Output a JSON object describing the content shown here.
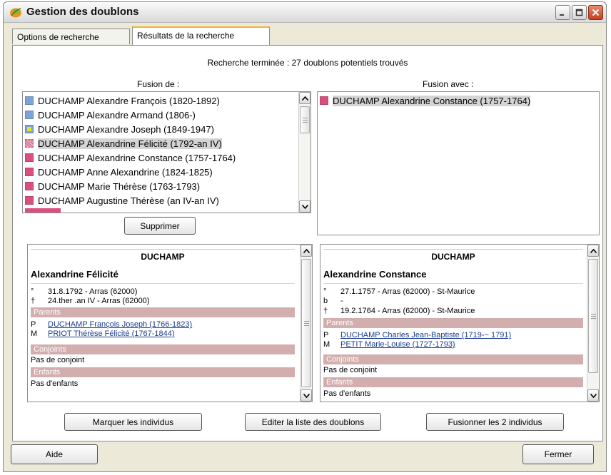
{
  "window": {
    "title": "Gestion des doublons"
  },
  "tabs": [
    {
      "label": "Options de recherche",
      "active": false
    },
    {
      "label": "Résultats de la recherche",
      "active": true
    }
  ],
  "status_text": "Recherche terminée : 27 doublons potentiels trouvés",
  "fusion_de": {
    "label": "Fusion de :",
    "items": [
      {
        "label": "DUCHAMP Alexandre François (1820-1892)",
        "color": "#7ea3d8"
      },
      {
        "label": "DUCHAMP Alexandre Armand (1806-)",
        "color": "#7ea3d8"
      },
      {
        "label": "DUCHAMP Alexandre Joseph (1849-1947)",
        "color": "#7ea3d8"
      },
      {
        "label": "DUCHAMP Alexandrine Félicité (1792-an IV)",
        "color": "#d9799a"
      },
      {
        "label": "DUCHAMP Alexandrine Constance (1757-1764)",
        "color": "#d9507f"
      },
      {
        "label": "DUCHAMP Anne Alexandrine (1824-1825)",
        "color": "#d9507f"
      },
      {
        "label": "DUCHAMP Marie Thérèse (1763-1793)",
        "color": "#d9507f"
      },
      {
        "label": "DUCHAMP Augustine Thérèse (an IV-an IV)",
        "color": "#d9507f"
      }
    ]
  },
  "fusion_avec": {
    "label": "Fusion avec :",
    "items": [
      {
        "label": "DUCHAMP Alexandrine Constance (1757-1764)",
        "color": "#d9507f"
      }
    ]
  },
  "buttons": {
    "supprimer": "Supprimer",
    "marquer": "Marquer les individus",
    "editer": "Editer la liste des doublons",
    "fusionner": "Fusionner les 2 individus",
    "aide": "Aide",
    "fermer": "Fermer"
  },
  "left_card": {
    "surname": "DUCHAMP",
    "given": "Alexandrine Félicité",
    "events": [
      {
        "sym": "°",
        "text": "31.8.1792 - Arras (62000)"
      },
      {
        "sym": "†",
        "text": "24.ther .an IV - Arras (62000)"
      }
    ],
    "parents_label": "Parents",
    "parents": [
      {
        "sym": "P",
        "text": "DUCHAMP François Joseph (1766-1823)"
      },
      {
        "sym": "M",
        "text": "PRIOT Thérèse Félicité (1767-1844)"
      }
    ],
    "conjoints_label": "Conjoints",
    "conjoints_text": "Pas de conjoint",
    "enfants_label": "Enfants",
    "enfants_text": "Pas d'enfants"
  },
  "right_card": {
    "surname": "DUCHAMP",
    "given": "Alexandrine Constance",
    "events": [
      {
        "sym": "°",
        "text": "27.1.1757 - Arras (62000) - St-Maurice"
      },
      {
        "sym": "b",
        "text": "-"
      },
      {
        "sym": "†",
        "text": "19.2.1764 - Arras (62000) - St-Maurice"
      }
    ],
    "parents_label": "Parents",
    "parents": [
      {
        "sym": "P",
        "text": "DUCHAMP Charles Jean-Baptiste (1719-~ 1791)"
      },
      {
        "sym": "M",
        "text": "PETIT Marie-Louise (1727-1793)"
      }
    ],
    "conjoints_label": "Conjoints",
    "conjoints_text": "Pas de conjoint",
    "enfants_label": "Enfants",
    "enfants_text": "Pas d'enfants"
  }
}
